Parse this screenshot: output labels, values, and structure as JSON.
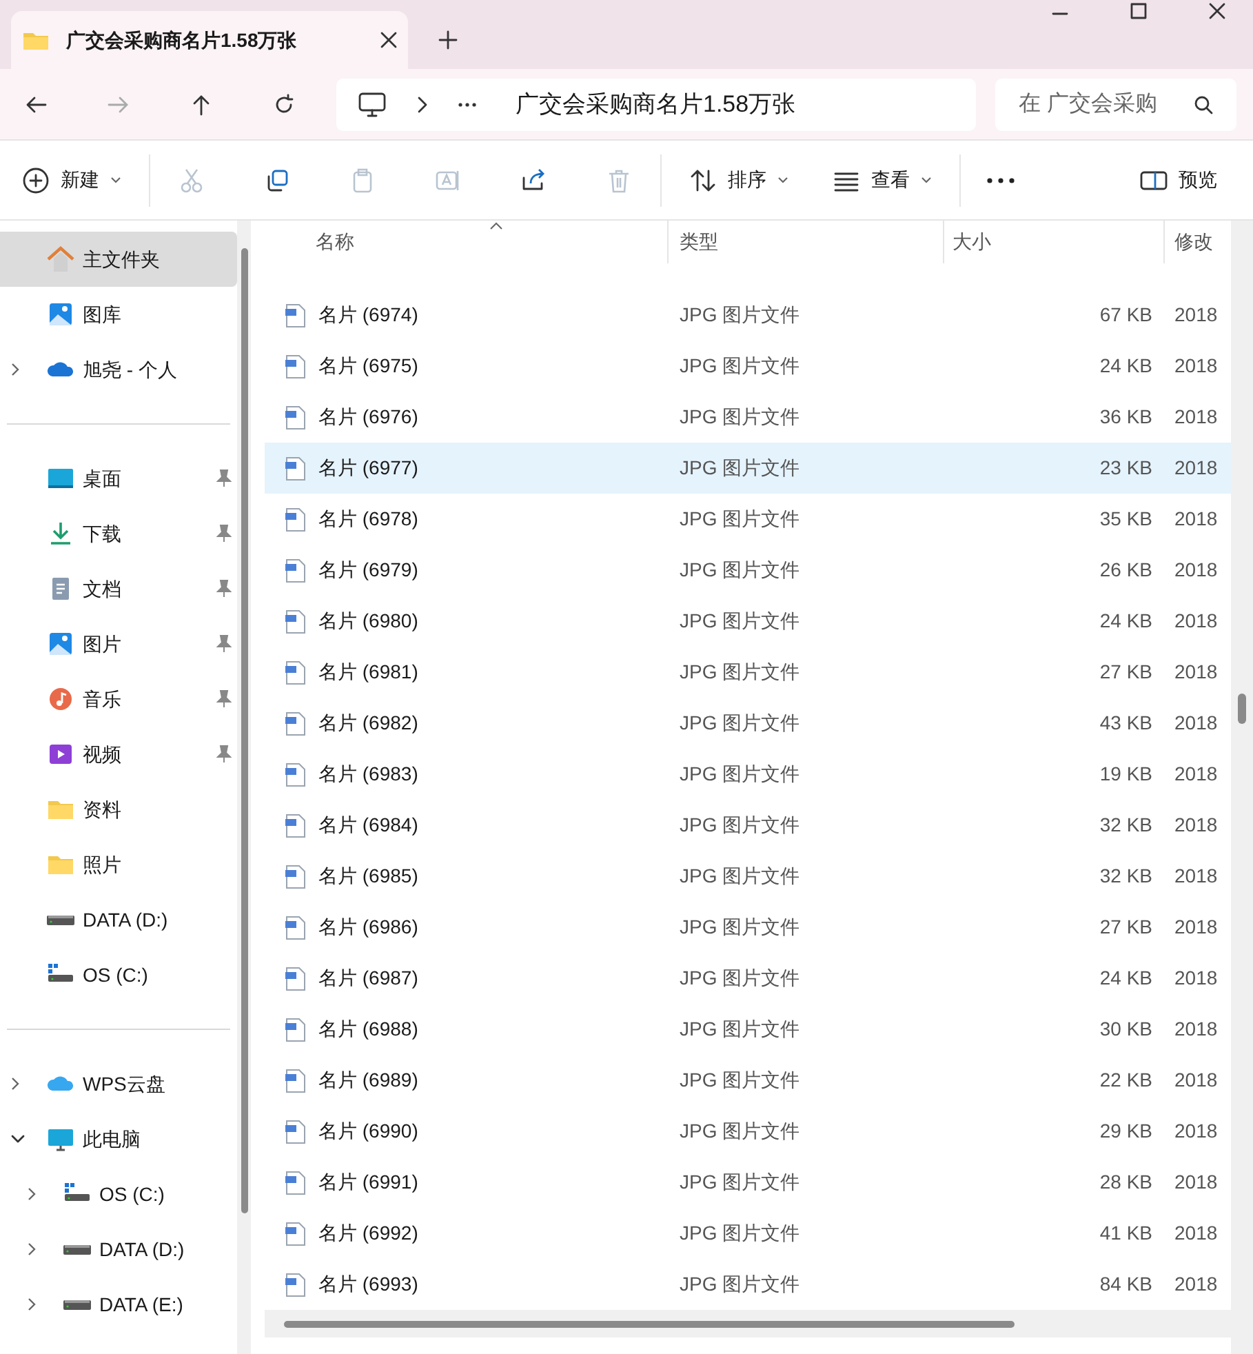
{
  "tab": {
    "title": "广交会采购商名片1.58万张"
  },
  "address_bar": {
    "path": "广交会采购商名片1.58万张",
    "search_placeholder": "在 广交会采购"
  },
  "toolbar": {
    "new": "新建",
    "sort": "排序",
    "view": "查看",
    "preview": "预览"
  },
  "sidebar": {
    "sections": [
      [
        {
          "label": "主文件夹",
          "kind": "home",
          "selected": true
        },
        {
          "label": "图库",
          "kind": "gallery",
          "selected": false
        },
        {
          "label": "旭尧 - 个人",
          "kind": "cloud",
          "selected": false,
          "expanded": false
        }
      ],
      [
        {
          "label": "桌面",
          "kind": "desktop",
          "selected": false,
          "pinned": true
        },
        {
          "label": "下载",
          "kind": "download",
          "selected": false,
          "pinned": true
        },
        {
          "label": "文档",
          "kind": "document",
          "selected": false,
          "pinned": true
        },
        {
          "label": "图片",
          "kind": "gallery",
          "selected": false,
          "pinned": true
        },
        {
          "label": "音乐",
          "kind": "music",
          "selected": false,
          "pinned": true
        },
        {
          "label": "视频",
          "kind": "video",
          "selected": false,
          "pinned": true
        },
        {
          "label": "资料",
          "kind": "folder",
          "selected": false
        },
        {
          "label": "照片",
          "kind": "folder",
          "selected": false
        },
        {
          "label": "DATA (D:)",
          "kind": "drive",
          "selected": false
        },
        {
          "label": "OS (C:)",
          "kind": "osdrive",
          "selected": false
        }
      ],
      [
        {
          "label": "WPS云盘",
          "kind": "wps",
          "selected": false,
          "expanded": false
        },
        {
          "label": "此电脑",
          "kind": "pc",
          "selected": false,
          "expanded": true,
          "children": [
            {
              "label": "OS (C:)",
              "kind": "osdrive",
              "selected": false,
              "expanded": false
            },
            {
              "label": "DATA (D:)",
              "kind": "drive",
              "selected": false,
              "expanded": false
            },
            {
              "label": "DATA (E:)",
              "kind": "drive",
              "selected": false,
              "expanded": false
            }
          ]
        }
      ]
    ]
  },
  "table": {
    "columns": [
      "名称",
      "类型",
      "大小",
      "修改"
    ],
    "rows": [
      {
        "name": "名片 (6974)",
        "type": "JPG 图片文件",
        "size": "67 KB",
        "date": "2018",
        "selected": false
      },
      {
        "name": "名片 (6975)",
        "type": "JPG 图片文件",
        "size": "24 KB",
        "date": "2018",
        "selected": false
      },
      {
        "name": "名片 (6976)",
        "type": "JPG 图片文件",
        "size": "36 KB",
        "date": "2018",
        "selected": false
      },
      {
        "name": "名片 (6977)",
        "type": "JPG 图片文件",
        "size": "23 KB",
        "date": "2018",
        "selected": true
      },
      {
        "name": "名片 (6978)",
        "type": "JPG 图片文件",
        "size": "35 KB",
        "date": "2018",
        "selected": false
      },
      {
        "name": "名片 (6979)",
        "type": "JPG 图片文件",
        "size": "26 KB",
        "date": "2018",
        "selected": false
      },
      {
        "name": "名片 (6980)",
        "type": "JPG 图片文件",
        "size": "24 KB",
        "date": "2018",
        "selected": false
      },
      {
        "name": "名片 (6981)",
        "type": "JPG 图片文件",
        "size": "27 KB",
        "date": "2018",
        "selected": false
      },
      {
        "name": "名片 (6982)",
        "type": "JPG 图片文件",
        "size": "43 KB",
        "date": "2018",
        "selected": false
      },
      {
        "name": "名片 (6983)",
        "type": "JPG 图片文件",
        "size": "19 KB",
        "date": "2018",
        "selected": false
      },
      {
        "name": "名片 (6984)",
        "type": "JPG 图片文件",
        "size": "32 KB",
        "date": "2018",
        "selected": false
      },
      {
        "name": "名片 (6985)",
        "type": "JPG 图片文件",
        "size": "32 KB",
        "date": "2018",
        "selected": false
      },
      {
        "name": "名片 (6986)",
        "type": "JPG 图片文件",
        "size": "27 KB",
        "date": "2018",
        "selected": false
      },
      {
        "name": "名片 (6987)",
        "type": "JPG 图片文件",
        "size": "24 KB",
        "date": "2018",
        "selected": false
      },
      {
        "name": "名片 (6988)",
        "type": "JPG 图片文件",
        "size": "30 KB",
        "date": "2018",
        "selected": false
      },
      {
        "name": "名片 (6989)",
        "type": "JPG 图片文件",
        "size": "22 KB",
        "date": "2018",
        "selected": false
      },
      {
        "name": "名片 (6990)",
        "type": "JPG 图片文件",
        "size": "29 KB",
        "date": "2018",
        "selected": false
      },
      {
        "name": "名片 (6991)",
        "type": "JPG 图片文件",
        "size": "28 KB",
        "date": "2018",
        "selected": false
      },
      {
        "name": "名片 (6992)",
        "type": "JPG 图片文件",
        "size": "41 KB",
        "date": "2018",
        "selected": false
      },
      {
        "name": "名片 (6993)",
        "type": "JPG 图片文件",
        "size": "84 KB",
        "date": "2018",
        "selected": false
      }
    ]
  }
}
